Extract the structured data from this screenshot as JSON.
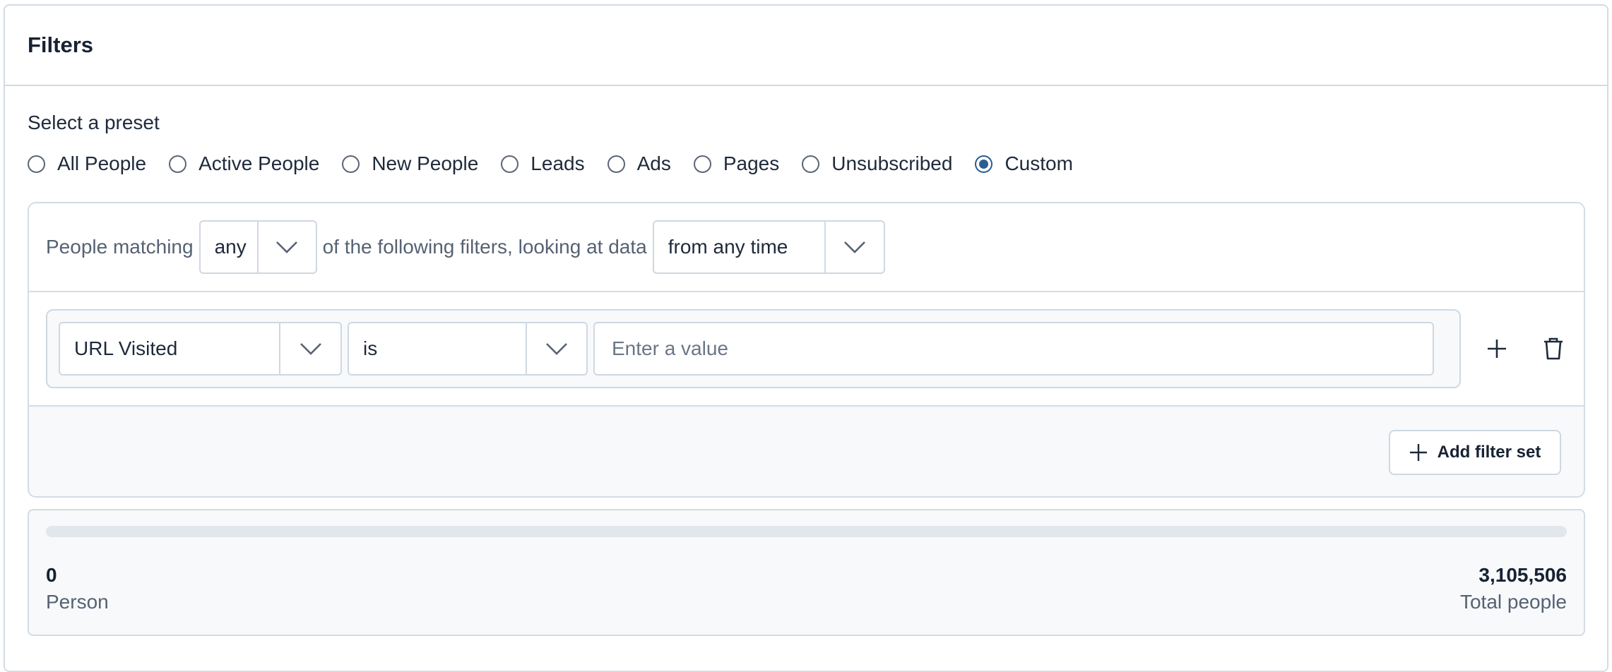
{
  "panel": {
    "title": "Filters"
  },
  "preset": {
    "label": "Select a preset",
    "options": [
      {
        "label": "All People",
        "checked": false
      },
      {
        "label": "Active People",
        "checked": false
      },
      {
        "label": "New People",
        "checked": false
      },
      {
        "label": "Leads",
        "checked": false
      },
      {
        "label": "Ads",
        "checked": false
      },
      {
        "label": "Pages",
        "checked": false
      },
      {
        "label": "Unsubscribed",
        "checked": false
      },
      {
        "label": "Custom",
        "checked": true
      }
    ]
  },
  "match": {
    "prefix": "People matching",
    "mode": "any",
    "middle": "of the following filters, looking at data",
    "timeframe": "from any time"
  },
  "rule": {
    "field": "URL Visited",
    "operator": "is",
    "value": "",
    "placeholder": "Enter a value",
    "add_icon": "plus-icon",
    "delete_icon": "trash-icon"
  },
  "add_filter_set": {
    "label": "Add filter set",
    "icon": "plus-icon"
  },
  "summary": {
    "matched_count": "0",
    "matched_label": "Person",
    "total_count": "3,105,506",
    "total_label": "Total people",
    "progress": 0
  },
  "colors": {
    "accent": "#2b5f8f",
    "border": "#d3dce6",
    "muted_text": "#566273"
  }
}
